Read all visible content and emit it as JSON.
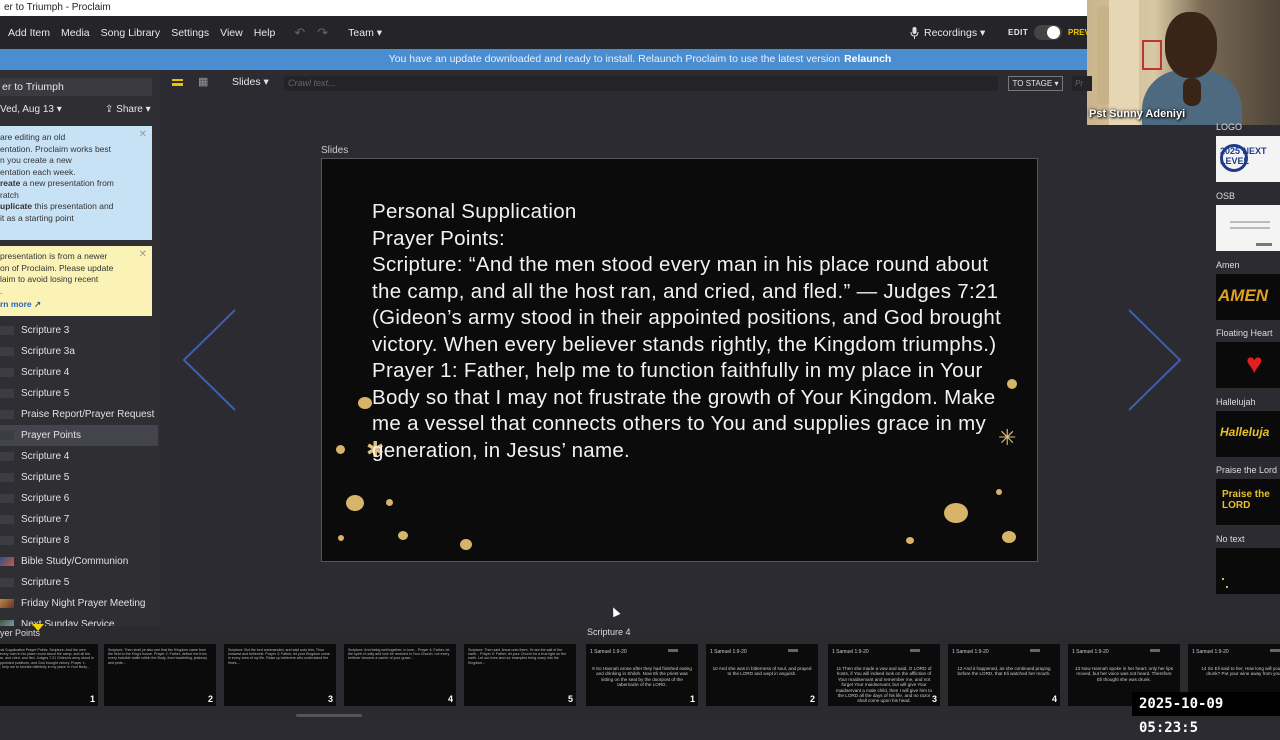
{
  "window": {
    "title": "er to Triumph - Proclaim"
  },
  "menu": [
    "Add Item",
    "Media",
    "Song Library",
    "Settings",
    "View",
    "Help"
  ],
  "team_label": "Team ▾",
  "recordings_label": "Recordings ▾",
  "edit_label": "EDIT",
  "preview_label": "PREV",
  "banner": {
    "message": "You have an update downloaded and ready to install. Relaunch Proclaim to use the latest version",
    "action": "Relaunch"
  },
  "webcam": {
    "name": "Pst Sunny Adeniyi"
  },
  "presentation": {
    "title": "er to Triumph",
    "date": "Ved, Aug 13 ▾",
    "share": "Share ▾"
  },
  "notes": {
    "blue": [
      "are editing an old",
      "entation. Proclaim works best",
      "n you create a new",
      "entation each week.",
      "reate a new presentation from",
      "ratch",
      "uplicate this presentation and",
      "it as a starting point"
    ],
    "blue_bold": [
      "reate",
      "uplicate"
    ],
    "yellow": [
      "presentation is from a newer",
      "on of Proclaim. Please update",
      "laim to avoid losing recent",
      "."
    ],
    "yellow_link": "rn more ↗"
  },
  "items": [
    "Scripture 3",
    "Scripture 3a",
    "Scripture 4",
    "Scripture 5",
    "Praise Report/Prayer Request",
    "Prayer Points",
    "Scripture 4",
    "Scripture 5",
    "Scripture 6",
    "Scripture 7",
    "Scripture 8",
    "Bible Study/Communion",
    "Scripture 5",
    "Friday Night Prayer Meeting",
    "Next Sunday Service"
  ],
  "toolbar": {
    "slides_label": "Slides ▾",
    "crawl_placeholder": "Crawl text...",
    "to_stage": "TO STAGE ▾",
    "p_placeholder": "Pr"
  },
  "slides_label": "Slides",
  "slide": {
    "text": "Personal Supplication\nPrayer Points:\nScripture: “And the men stood every man in his place round about the camp, and all the host ran, and cried, and fled.” — Judges 7:21 (Gideon’s army stood in their appointed positions, and God brought victory. When every believer stands rightly, the Kingdom triumphs.)\nPrayer 1: Father, help me to function faithfully in my place in Your Body so that I may not frustrate the growth of Your Kingdom. Make me a vessel that connects others to You and supplies grace in my generation, in Jesus’ name."
  },
  "right_panel": [
    {
      "label": "LOGO",
      "thumb": "2025 NEXT LEVEL"
    },
    {
      "label": "OSB",
      "thumb": ""
    },
    {
      "label": "Amen",
      "thumb": "AMEN"
    },
    {
      "label": "Floating Heart",
      "thumb": "♥"
    },
    {
      "label": "Hallelujah",
      "thumb": "Halleluja"
    },
    {
      "label": "Praise the Lord",
      "thumb": "Praise the LORD"
    },
    {
      "label": "No text",
      "thumb": ""
    }
  ],
  "bottom": {
    "left_label": "yer Points",
    "right_label": "Scripture 4",
    "thumbs": [
      {
        "head": "",
        "text": "Personal Supplication Prayer Points: Scripture: And the men stood every man in his place round about the camp, and all the host ran, and cried, and fled. Judges 7:21 Gideon's army stood in their appointed positions, and God brought victory. Prayer 1: Father, help me to function faithfully in my place in Your Body...",
        "num": "1"
      },
      {
        "head": "",
        "text": "Scripture: Then shall ye also see that the Kingdom came from the field to the King's house. Prayer 2: Father, deliver me from every invisible battle within the Body, from backbiting, jealousy and pride...",
        "num": "2"
      },
      {
        "head": "",
        "text": "Scripture: But the lord commanded, and said unto him, Thou knowest and believest. Prayer 3: Father, let your Kingdom come in every area of my life. Raise up believers who understand the times...",
        "num": "3"
      },
      {
        "head": "",
        "text": "Scripture: And being well together, in love... Prayer 4: Father, let the spirit of unity and love be restored in Your Church. Let every believer become a carrier of your grace...",
        "num": "4"
      },
      {
        "head": "",
        "text": "Scripture: Then said Jesus unto them, Ye are the salt of the earth... Prayer 5: Father, let your Church be a true light on the earth. Let our lives and our examples bring many into the Kingdom...",
        "num": "5"
      },
      {
        "head": "1 Samuel 1:9-20",
        "text": "9 So Hannah arose after they had finished eating and drinking in Shiloh. Now Eli the priest was sitting on the seat by the doorpost of the tabernacle of the LORD.",
        "num": "1"
      },
      {
        "head": "1 Samuel 1:9-20",
        "text": "10 And she was in bitterness of soul, and prayed to the LORD and wept in anguish.",
        "num": "2"
      },
      {
        "head": "1 Samuel 1:9-20",
        "text": "11 Then she made a vow and said, O LORD of hosts, if You will indeed look on the affliction of Your maidservant and remember me, and not forget Your maidservant, but will give Your maidservant a male child, then I will give him to the LORD all the days of his life, and no razor shall come upon his head.",
        "num": "3"
      },
      {
        "head": "1 Samuel 1:9-20",
        "text": "12 And it happened, as she continued praying before the LORD, that Eli watched her mouth.",
        "num": "4"
      },
      {
        "head": "1 Samuel 1:9-20",
        "text": "13 Now Hannah spoke in her heart; only her lips moved, but her voice was not heard. Therefore Eli thought she was drunk.",
        "num": "5"
      },
      {
        "head": "1 Samuel 1:9-20",
        "text": "14 So Eli said to her, How long will you be drunk? Put your wine away from you!",
        "num": "6"
      }
    ]
  },
  "timestamp": "2025-10-09  05:23:5"
}
